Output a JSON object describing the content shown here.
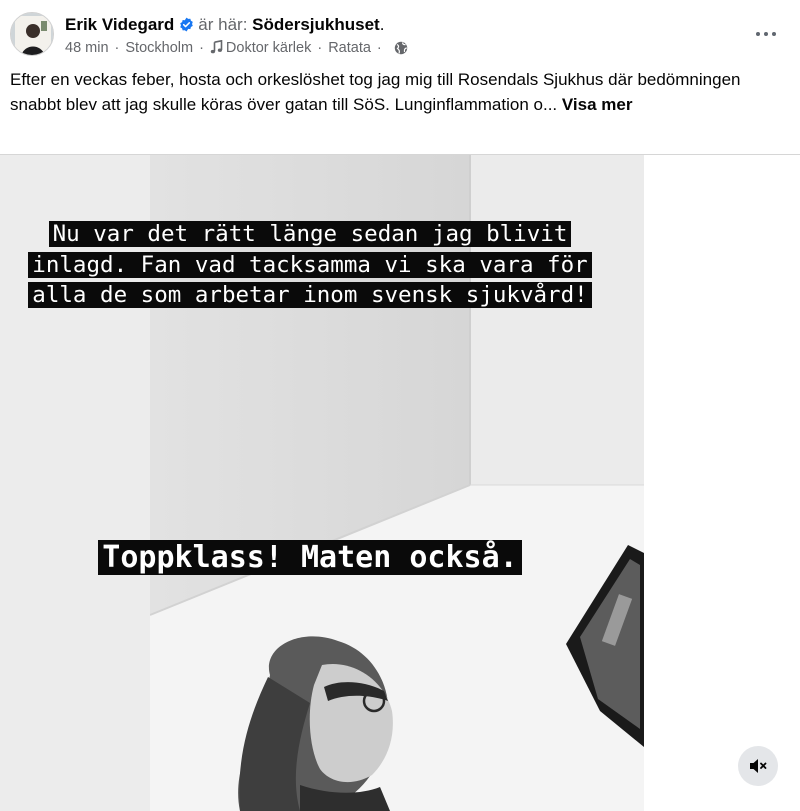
{
  "post": {
    "author": "Erik Videgard",
    "is_at": "är här:",
    "place": "Södersjukhuset",
    "place_suffix": ".",
    "time": "48 min",
    "separator": "·",
    "location": "Stockholm",
    "song": "Doktor kärlek",
    "artist": "Ratata",
    "body": "Efter en veckas feber, hosta och orkeslöshet tog jag mig till Rosendals Sjukhus där bedömningen snabbt blev att jag skulle köras över gatan till SöS. Lunginflammation o...",
    "see_more": "Visa mer"
  },
  "story": {
    "caption_1": "Nu var det rätt länge sedan jag blivit inlagd. Fan vad tacksamma vi ska vara för alla de som arbetar inom svensk sjukvård!",
    "caption_2": "Toppklass! Maten också."
  },
  "icons": {
    "verified": "verified-badge-icon",
    "music": "music-note-icon",
    "audience": "globe-icon",
    "more": "more-dots-icon",
    "mute": "speaker-muted-icon"
  },
  "colors": {
    "verified_blue": "#1877f2",
    "secondary_text": "#65676b",
    "caption_highlight": "#0a0a0a"
  }
}
